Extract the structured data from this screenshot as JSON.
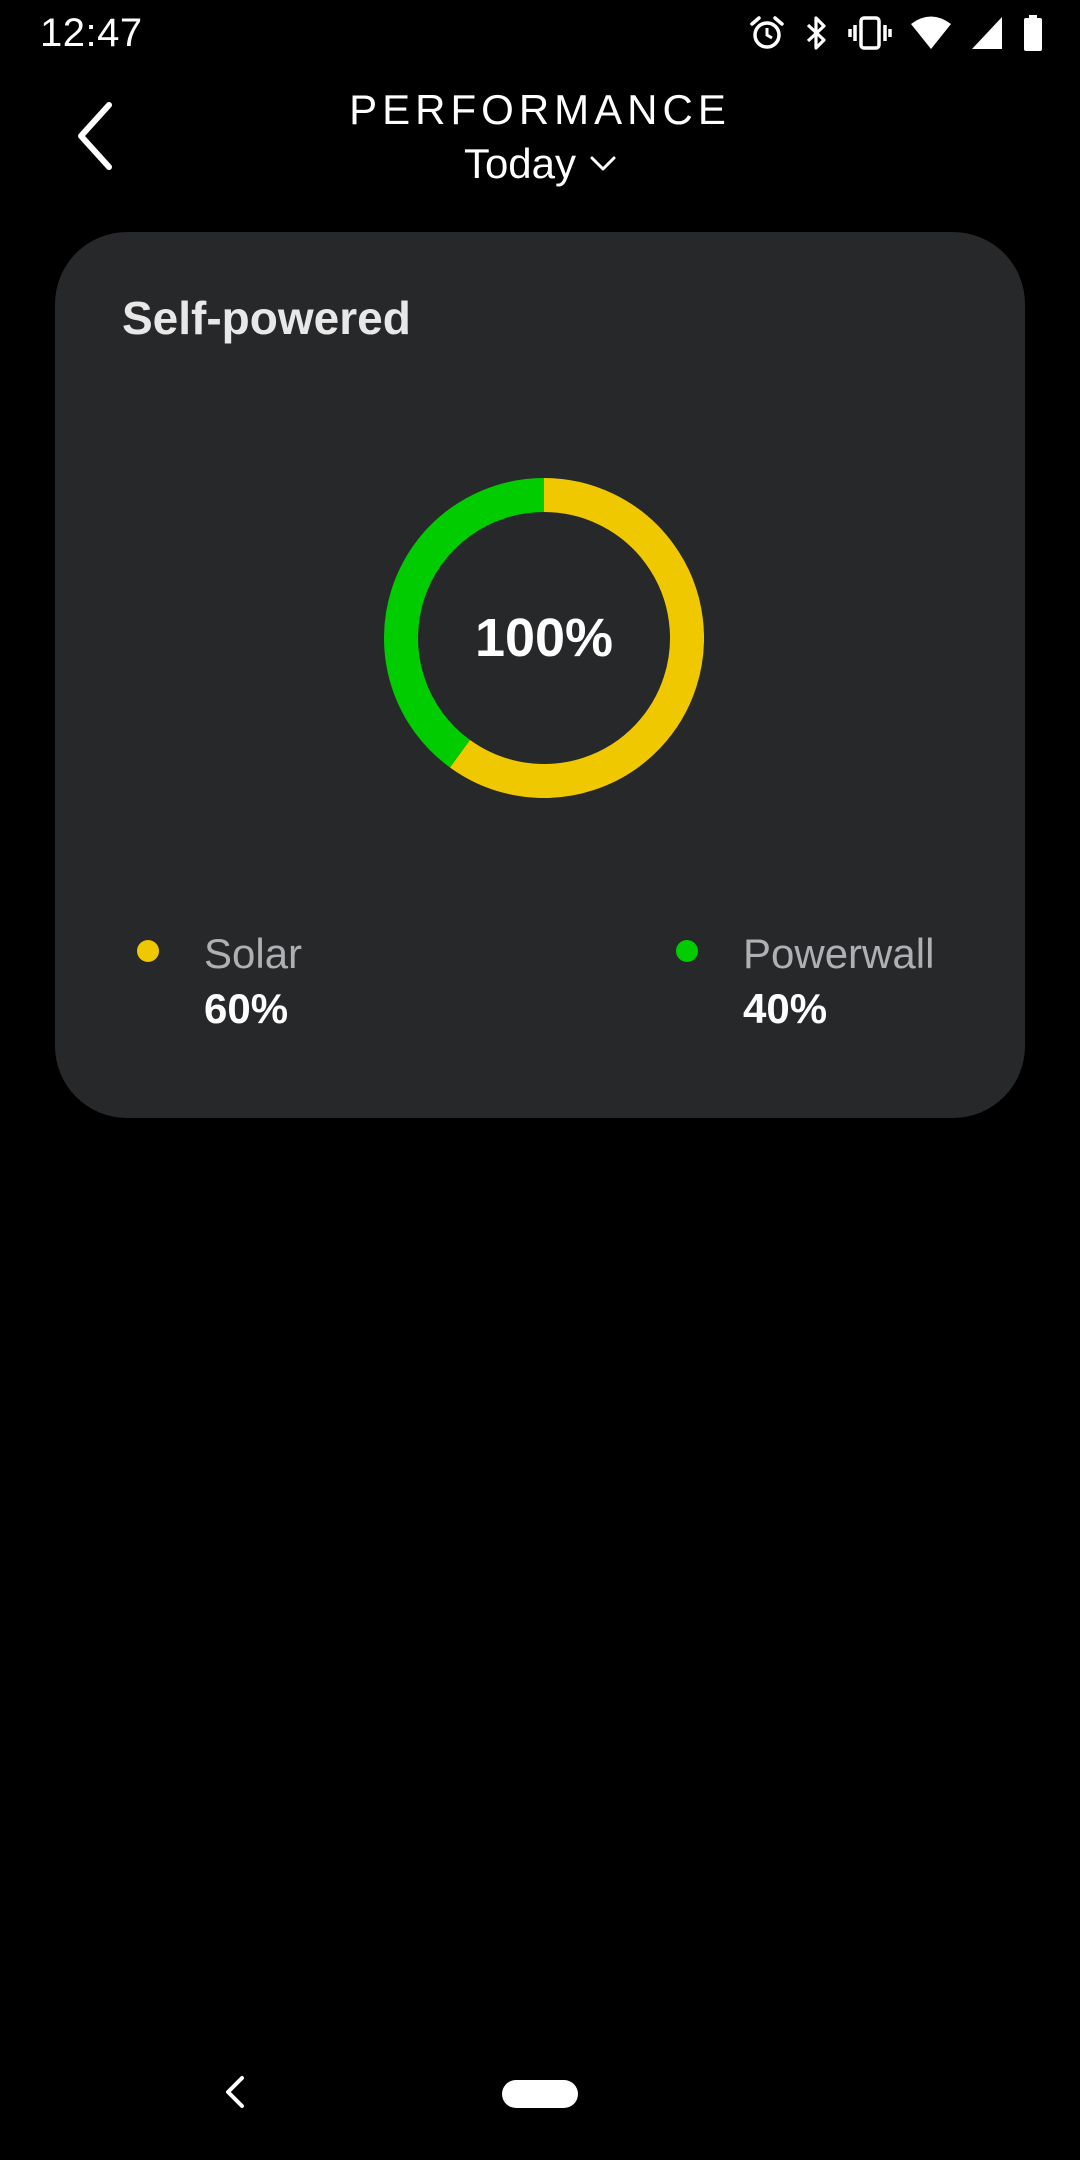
{
  "status_bar": {
    "time": "12:47",
    "icons": [
      "alarm-icon",
      "bluetooth-icon",
      "vibrate-icon",
      "wifi-icon",
      "cell-signal-icon",
      "battery-icon"
    ]
  },
  "header": {
    "title": "PERFORMANCE",
    "period": "Today",
    "back_icon": "chevron-left-icon",
    "period_icon": "chevron-down-icon"
  },
  "card": {
    "title": "Self-powered",
    "center_value": "100%",
    "chart_data": {
      "type": "pie",
      "categories": [
        "Solar",
        "Powerwall"
      ],
      "values": [
        60,
        40
      ],
      "colors": [
        "#f0c800",
        "#00cc00"
      ]
    },
    "legend": [
      {
        "label": "Solar",
        "value": "60%",
        "color": "#f0c800"
      },
      {
        "label": "Powerwall",
        "value": "40%",
        "color": "#00cc00"
      }
    ]
  },
  "nav_bar": {
    "back_icon": "nav-back-icon",
    "home_icon": "home-pill-icon"
  },
  "colors": {
    "background": "#000000",
    "card": "#27282a",
    "solar": "#f0c800",
    "powerwall": "#00cc00"
  }
}
